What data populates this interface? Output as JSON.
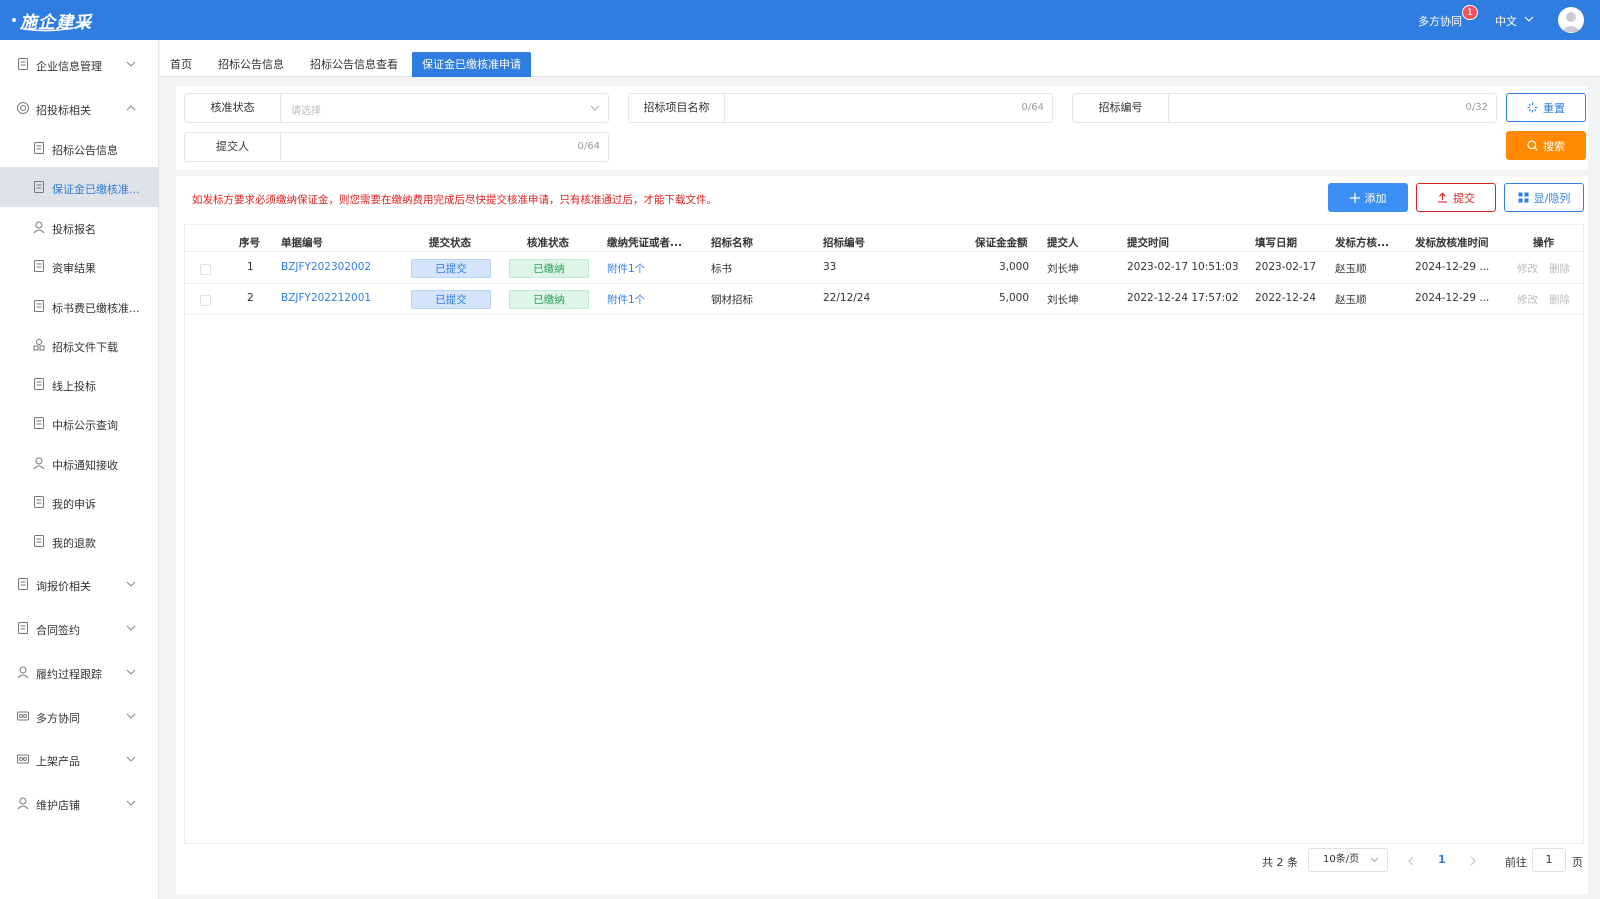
{
  "header": {
    "logo_text": "施企建采",
    "collab_label": "多方协同",
    "collab_badge": "1",
    "language": "中文"
  },
  "sidebar": {
    "items": [
      {
        "label": "企业信息管理",
        "icon": "document-icon",
        "type": "group",
        "expanded": false
      },
      {
        "label": "招投标相关",
        "icon": "target-icon",
        "type": "group",
        "expanded": true
      },
      {
        "label": "招标公告信息",
        "icon": "doc-list-icon",
        "type": "sub"
      },
      {
        "label": "保证金已缴核准...",
        "icon": "clipboard-icon",
        "type": "sub",
        "active": true
      },
      {
        "label": "投标报名",
        "icon": "user-icon",
        "type": "sub"
      },
      {
        "label": "资审结果",
        "icon": "check-clipboard-icon",
        "type": "sub"
      },
      {
        "label": "标书费已缴核准...",
        "icon": "doc-stamp-icon",
        "type": "sub"
      },
      {
        "label": "招标文件下载",
        "icon": "download-icon",
        "type": "sub"
      },
      {
        "label": "线上投标",
        "icon": "online-bid-icon",
        "type": "sub"
      },
      {
        "label": "中标公示查询",
        "icon": "notice-icon",
        "type": "sub"
      },
      {
        "label": "中标通知接收",
        "icon": "user-notify-icon",
        "type": "sub"
      },
      {
        "label": "我的申诉",
        "icon": "appeal-icon",
        "type": "sub"
      },
      {
        "label": "我的退款",
        "icon": "refund-icon",
        "type": "sub"
      },
      {
        "label": "询报价相关",
        "icon": "quote-icon",
        "type": "group",
        "expanded": false
      },
      {
        "label": "合同签约",
        "icon": "contract-icon",
        "type": "group",
        "expanded": false
      },
      {
        "label": "履约过程跟踪",
        "icon": "track-icon",
        "type": "group",
        "expanded": false
      },
      {
        "label": "多方协同",
        "icon": "collab-icon",
        "type": "group",
        "expanded": false
      },
      {
        "label": "上架产品",
        "icon": "product-icon",
        "type": "group",
        "expanded": false
      },
      {
        "label": "维护店铺",
        "icon": "store-icon",
        "type": "group",
        "expanded": false
      }
    ]
  },
  "tabs": [
    {
      "label": "首页"
    },
    {
      "label": "招标公告信息"
    },
    {
      "label": "招标公告信息查看"
    },
    {
      "label": "保证金已缴核准申请",
      "active": true
    }
  ],
  "filters": {
    "status_label": "核准状态",
    "status_placeholder": "请选择",
    "project_label": "招标项目名称",
    "project_count": "0/64",
    "code_label": "招标编号",
    "code_count": "0/32",
    "submitter_label": "提交人",
    "submitter_count": "0/64",
    "reset_label": "重置",
    "search_label": "搜索"
  },
  "toolbar": {
    "notice": "如发标方要求必须缴纳保证金，则您需要在缴纳费用完成后尽快提交核准申请，只有核准通过后，才能下载文件。",
    "add_label": "添加",
    "submit_label": "提交",
    "columns_label": "显/隐列"
  },
  "table": {
    "columns": [
      "序号",
      "单据编号",
      "提交状态",
      "核准状态",
      "缴纳凭证或者...",
      "招标名称",
      "招标编号",
      "保证金金额",
      "提交人",
      "提交时间",
      "填写日期",
      "发标方核...",
      "发标放核准时间",
      "操作"
    ],
    "rows": [
      {
        "index": "1",
        "doc_no": "BZJFY202302002",
        "submit_status": "已提交",
        "approve_status": "已缴纳",
        "voucher": "附件1个",
        "tender_name": "标书",
        "tender_no": "33",
        "amount": "3,000",
        "submitter": "刘长坤",
        "submit_time": "2023-02-17 10:51:03",
        "fill_date": "2023-02-17",
        "approver": "赵玉顺",
        "approve_time": "2024-12-29 ...",
        "edit": "修改",
        "delete": "删除"
      },
      {
        "index": "2",
        "doc_no": "BZJFY202212001",
        "submit_status": "已提交",
        "approve_status": "已缴纳",
        "voucher": "附件1个",
        "tender_name": "钢材招标",
        "tender_no": "22/12/24",
        "amount": "5,000",
        "submitter": "刘长坤",
        "submit_time": "2022-12-24 17:57:02",
        "fill_date": "2022-12-24",
        "approver": "赵玉顺",
        "approve_time": "2024-12-29 ...",
        "edit": "修改",
        "delete": "删除"
      }
    ]
  },
  "pagination": {
    "total": "共 2 条",
    "page_size": "10条/页",
    "current_page": "1",
    "goto_label": "前往",
    "goto_value": "1",
    "page_suffix": "页"
  },
  "colors": {
    "primary": "#2f7de1",
    "search_button": "#ff8a00",
    "notice_text": "#e02020",
    "tag_blue": "#d4e4fb",
    "tag_green": "#dcf5e6"
  }
}
